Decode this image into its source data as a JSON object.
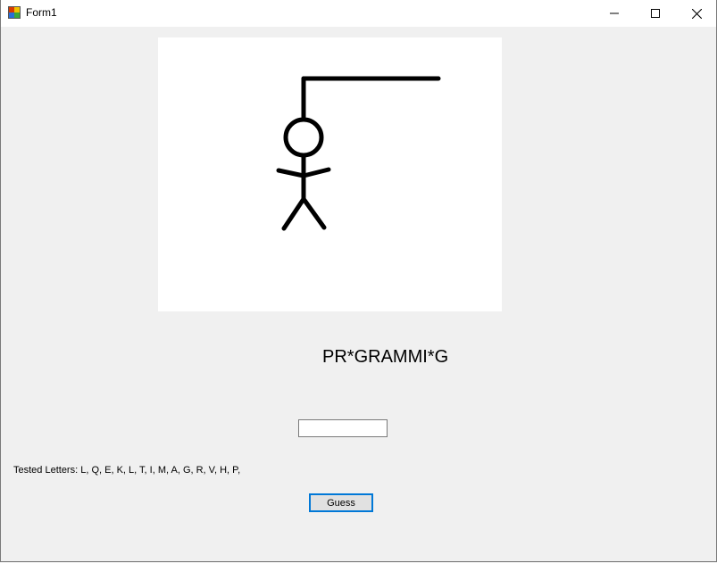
{
  "window": {
    "title": "Form1",
    "minimize_glyph": "–",
    "maximize_glyph": "☐",
    "close_glyph": "✕"
  },
  "game": {
    "masked_word": "PR*GRAMMI*G",
    "guess_value": "",
    "tested_letters_label": "Tested Letters:",
    "tested_letters": "L, Q, E, K, L, T, I, M, A, G, R, V, H, P,",
    "guess_button_label": "Guess"
  },
  "icons": {
    "app": "app-icon",
    "minimize": "minimize-icon",
    "maximize": "maximize-icon",
    "close": "close-icon"
  },
  "colors": {
    "window_bg": "#f0f0f0",
    "canvas_bg": "#ffffff",
    "drawing": "#000000",
    "button_border": "#0078d7"
  }
}
